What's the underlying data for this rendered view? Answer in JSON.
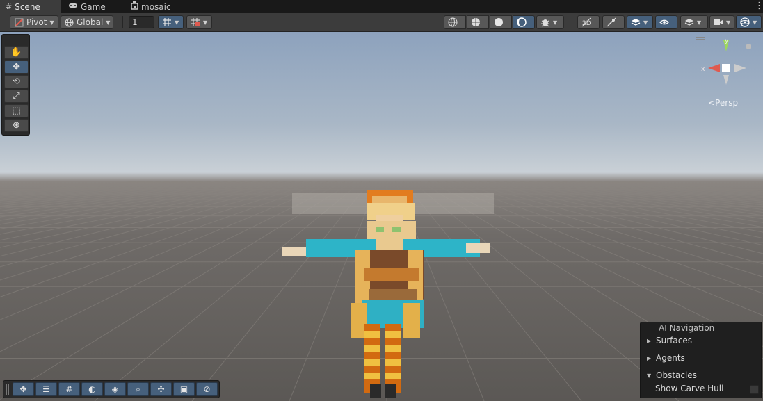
{
  "tabs": [
    {
      "label": "Scene",
      "icon": "grid-hash-icon",
      "active": true
    },
    {
      "label": "Game",
      "icon": "gamepad-icon",
      "active": false
    },
    {
      "label": "mosaic",
      "icon": "unity-object-icon",
      "active": false
    }
  ],
  "toolbar": {
    "pivot_label": "Pivot",
    "global_label": "Global",
    "grid_snap_value": "1"
  },
  "gizmo": {
    "x_label": "x",
    "y_label": "y",
    "persp_label": "Persp"
  },
  "nav_panel": {
    "title": "AI Navigation",
    "items": [
      {
        "label": "Surfaces",
        "expanded": false
      },
      {
        "label": "Agents",
        "expanded": false
      },
      {
        "label": "Obstacles",
        "expanded": true
      }
    ],
    "show_carve_hull_label": "Show Carve Hull",
    "show_carve_hull_checked": false
  },
  "colors": {
    "accent_selected": "#46607c",
    "toolbar_bg": "#3c3c3c",
    "gizmo_x": "#e05a4f",
    "gizmo_y": "#9ed85c"
  }
}
